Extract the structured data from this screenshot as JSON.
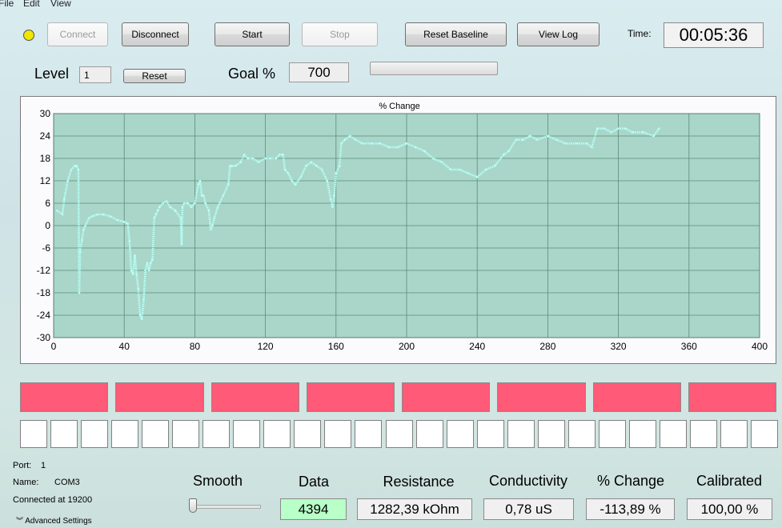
{
  "menu": {
    "file": "File",
    "edit": "Edit",
    "view": "View"
  },
  "toolbar": {
    "connect": "Connect",
    "disconnect": "Disconnect",
    "start": "Start",
    "stop": "Stop",
    "reset_baseline": "Reset Baseline",
    "view_log": "View Log",
    "time_label": "Time:",
    "time_value": "00:05:36",
    "status_led_color": "#f0e600"
  },
  "level": {
    "label": "Level",
    "value": "1",
    "reset": "Reset"
  },
  "goal": {
    "label": "Goal %",
    "value": "700"
  },
  "chart_data": {
    "type": "line",
    "title": "% Change",
    "xlabel": "",
    "ylabel": "",
    "xlim": [
      0,
      400
    ],
    "ylim": [
      -30,
      30
    ],
    "xticks": [
      0,
      40,
      80,
      120,
      160,
      200,
      240,
      280,
      320,
      360,
      400
    ],
    "yticks": [
      30,
      24,
      18,
      12,
      6,
      0,
      -6,
      -12,
      -18,
      -24,
      -30
    ],
    "grid": true,
    "background": "#a9d6c8",
    "line_color": "#b8fff6",
    "series": [
      {
        "x": [
          2,
          5,
          6,
          8,
          10,
          12,
          13,
          14,
          14.5,
          15,
          16,
          17,
          18,
          20,
          22,
          25,
          28,
          32,
          36,
          40,
          42,
          43,
          44,
          45,
          46,
          47,
          48,
          49,
          50,
          51,
          52,
          53,
          54,
          55,
          56,
          57,
          58,
          59,
          60,
          62,
          64,
          66,
          69,
          72,
          72.5,
          73,
          74,
          76,
          78,
          80,
          82,
          83,
          84,
          85,
          86,
          88,
          89,
          90,
          91,
          93,
          96,
          99,
          100,
          101,
          103,
          106,
          108,
          110,
          113,
          116,
          120,
          123,
          126,
          128,
          130,
          131,
          133,
          135,
          137,
          140,
          143,
          146,
          149,
          152,
          155,
          157,
          158,
          159,
          160,
          162,
          163,
          165,
          168,
          171,
          175,
          180,
          185,
          190,
          195,
          200,
          205,
          210,
          215,
          220,
          225,
          230,
          235,
          240,
          245,
          250,
          255,
          258,
          262,
          266,
          270,
          274,
          280,
          285,
          290,
          296,
          302,
          305,
          308,
          312,
          316,
          320,
          324,
          328,
          334,
          340,
          343
        ],
        "y": [
          4,
          3,
          7,
          12,
          15,
          16,
          16,
          15,
          -18,
          -7,
          -4,
          -1,
          0,
          2,
          2.5,
          3,
          3,
          2.5,
          1.5,
          1,
          0.5,
          -4,
          -12,
          -13,
          -8,
          -13,
          -17,
          -24,
          -25,
          -20,
          -12,
          -10,
          -12,
          -10,
          -9,
          2,
          3,
          4,
          5,
          6,
          6.5,
          5,
          4,
          2,
          -5,
          5,
          6,
          6,
          5,
          6,
          11,
          12,
          8,
          8,
          6,
          4,
          -1,
          0,
          2,
          5,
          8,
          11,
          16,
          16,
          16,
          17,
          19,
          18,
          18,
          17,
          18,
          18,
          18,
          19,
          19,
          15,
          14,
          12,
          11,
          13,
          16,
          17,
          16,
          15,
          12,
          7,
          5,
          8,
          14,
          16,
          22,
          23,
          24,
          23,
          22,
          22,
          22,
          21,
          21,
          22,
          21,
          20,
          18,
          17,
          15,
          15,
          14,
          13,
          15,
          16,
          19,
          20,
          23,
          23,
          24,
          23,
          24,
          23,
          22,
          22,
          22,
          21,
          26,
          26,
          25,
          26,
          26,
          25,
          25,
          24,
          26
        ]
      }
    ]
  },
  "indicators": {
    "red_count": 8,
    "white_count": 25,
    "red_color": "#ff5a78"
  },
  "port_info": {
    "port_label": "Port:",
    "port_value": "1",
    "name_label": "Name:",
    "name_value": "COM3",
    "connected": "Connected at 19200",
    "advanced": "Advanced Settings"
  },
  "readouts": {
    "smooth_label": "Smooth",
    "data_label": "Data",
    "data_value": "4394",
    "data_color": "#b8ffc8",
    "resistance_label": "Resistance",
    "resistance_value": "1282,39 kOhm",
    "conductivity_label": "Conductivity",
    "conductivity_value": "0,78 uS",
    "change_label": "% Change",
    "change_value": "-113,89 %",
    "calibrated_label": "Calibrated",
    "calibrated_value": "100,00 %"
  }
}
